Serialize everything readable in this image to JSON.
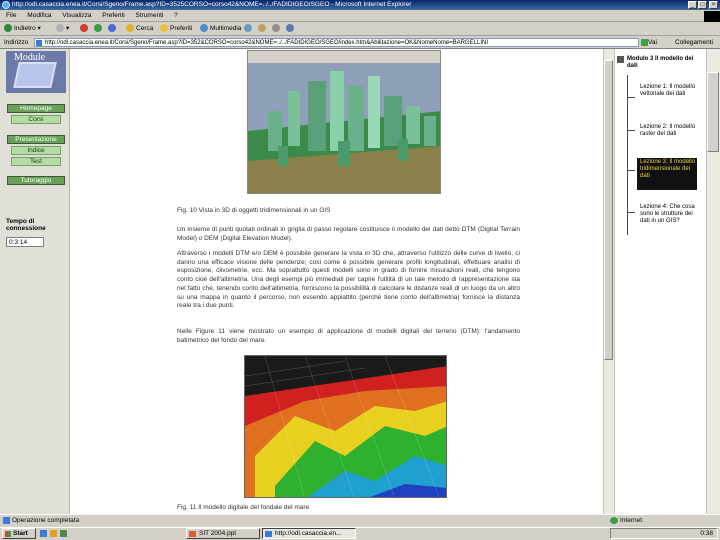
{
  "window": {
    "title": "http://odl.casaccia.enea.it/Corsi/Sgeno/Frame.asp?ID=3525CORSO=corso42&NOME=../../FADIDIGEO/SGEO - Microsoft Internet Explorer",
    "controls": [
      "_",
      "□",
      "×"
    ]
  },
  "menu": [
    "File",
    "Modifica",
    "Visualizza",
    "Preferiti",
    "Strumenti",
    "?"
  ],
  "toolbar": {
    "back": "Indietro",
    "search": "Cerca",
    "favorites": "Preferiti",
    "multimedia": "Multimedia"
  },
  "address": {
    "label": "Indirizzo",
    "url": "http://odl.casaccia.enea.it/Corsi/Sgeno/Frame.asp?ID=352&CORSO=corso42&NOME=../../FADIDIGEO/SGEO/index.htm&Abilitazione=OK&NomeNome=BARGELLINI",
    "go": "Vai",
    "links": "Collegamenti"
  },
  "logo": {
    "text": "Module"
  },
  "leftnav": {
    "homepage": "Homepage",
    "corsi": "Corsi",
    "presentazione": "Presentazione",
    "indice": "Indice",
    "test": "Test",
    "tutoraggio": "Tutoraggio",
    "tempo_label": "Tempo di connessione",
    "tempo_value": "0:3:14"
  },
  "content": {
    "fig10_caption": "Fig. 10 Vista in 3D di oggetti tridimensionali in un GIS",
    "para1": "Un insieme di punti quotati ordinati in griglia di passo regolare costituisce il modello dei dati detto DTM (Digital Terrain Model) o DEM (Digital Elevation Model).",
    "para2": "Attraverso i modelli DTM e/o DEM è possibile generare la vista in 3D che, attraverso l'utilizzo delle curve di livello, ci danno una efficace visione delle pendenze; così come è possibile generare profili longitudinali, effettuare analisi di esposizione, clivometrie, ecc. Ma soprattutto questi modelli sono in grado di fornire misurazioni reali, che tengono conto cioè dell'altimetria. Una degli esempi più immediati per capire l'utilità di un tale metodo di rappresentazione sta nel fatto che, tenendo conto dell'altimetria, forniscono la possibilità di calcolare le distanze reali di un luogo da un altro su una mappa in quanto il percorso, non essendo appiattito (perché tiene conto dell'altimetria) fornisce la distanza reale tra i due punti.",
    "para3": "Nelle Figure 11 viene mostrato un esempio di applicazione di modelli digitali del terreno (DTM): l'andamento batimetrico del fondo del mare.",
    "fig11_caption": "Fig. 11 Il modello digitale del fondale del mare"
  },
  "rightpanel": {
    "module_title": "Modulo 3 Il modello dei dati",
    "lessons": [
      "Lezione 1: Il modello vettoriale dei dati",
      "Lezione 2: Il modello raster dei dati",
      "Lezione 3: Il modello tridimensionale dei dati",
      "Lezione 4: Che cosa sono le strutture dei dati in un GIS?"
    ]
  },
  "status": {
    "text": "Operazione completata",
    "zone": "Internet"
  },
  "taskbar": {
    "start": "Start",
    "buttons": [
      "SIT 2004.ppt",
      "http://odl.casaccia.en..."
    ],
    "clock": "0:38"
  }
}
